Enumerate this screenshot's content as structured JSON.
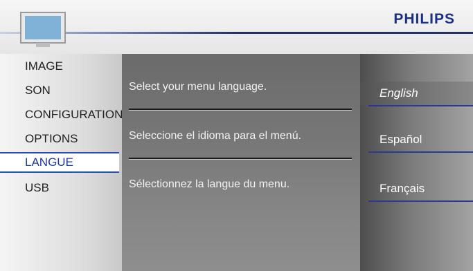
{
  "header": {
    "brand": "PHILIPS"
  },
  "sidebar": {
    "items": [
      {
        "label": "IMAGE"
      },
      {
        "label": "SON"
      },
      {
        "label": "CONFIGURATION"
      },
      {
        "label": "OPTIONS"
      },
      {
        "label": "LANGUE",
        "selected": true
      },
      {
        "label": "USB"
      }
    ]
  },
  "center": {
    "descriptions": [
      "Select your menu language.",
      "Seleccione el idioma para el menú.",
      "Sélectionnez la langue du menu."
    ]
  },
  "options": {
    "items": [
      {
        "label": "English",
        "selected": true
      },
      {
        "label": "Español"
      },
      {
        "label": "Français"
      }
    ]
  },
  "icons": {
    "tv": "tv-icon"
  },
  "colors": {
    "brand": "#1c2f86",
    "accent": "#2b4bb5"
  }
}
